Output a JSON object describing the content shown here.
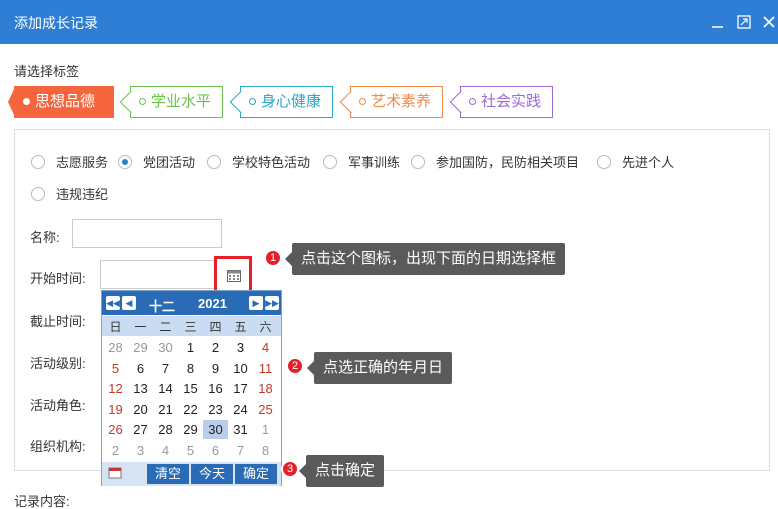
{
  "dialog": {
    "title": "添加成长记录",
    "icons": [
      "minimize-icon",
      "maximize-icon",
      "close-icon"
    ]
  },
  "section_label": "请选择标签",
  "tags": [
    {
      "label": "思想品德",
      "color": "#f5653e",
      "active": true
    },
    {
      "label": "学业水平",
      "color": "#6cc24a",
      "active": false
    },
    {
      "label": "身心健康",
      "color": "#2aa7c9",
      "active": false
    },
    {
      "label": "艺术素养",
      "color": "#f08c4a",
      "active": false
    },
    {
      "label": "社会实践",
      "color": "#9b6ad6",
      "active": false
    }
  ],
  "categories": {
    "options": [
      "志愿服务",
      "党团活动",
      "学校特色活动",
      "军事训练",
      "参加国防，民防相关项目",
      "先进个人",
      "违规违纪"
    ],
    "selected": "党团活动"
  },
  "form": {
    "name_label": "名称:",
    "start_label": "开始时间:",
    "end_label": "截止时间:",
    "level_label": "活动级别:",
    "role_label": "活动角色:",
    "org_label": "组织机构:",
    "record_label": "记录内容:"
  },
  "calendar": {
    "month": "十二",
    "year": "2021",
    "weekdays": [
      "日",
      "一",
      "二",
      "三",
      "四",
      "五",
      "六"
    ],
    "weeks": [
      [
        "28",
        "29",
        "30",
        "1",
        "2",
        "3",
        "4"
      ],
      [
        "5",
        "6",
        "7",
        "8",
        "9",
        "10",
        "11"
      ],
      [
        "12",
        "13",
        "14",
        "15",
        "16",
        "17",
        "18"
      ],
      [
        "19",
        "20",
        "21",
        "22",
        "23",
        "24",
        "25"
      ],
      [
        "26",
        "27",
        "28",
        "29",
        "30",
        "31",
        "1"
      ],
      [
        "2",
        "3",
        "4",
        "5",
        "6",
        "7",
        "8"
      ]
    ],
    "selected_day": "30",
    "clear_label": "清空",
    "today_label": "今天",
    "ok_label": "确定"
  },
  "callouts": [
    {
      "number": "1",
      "text": "点击这个图标，出现下面的日期选择框"
    },
    {
      "number": "2",
      "text": "点选正确的年月日"
    },
    {
      "number": "3",
      "text": "点击确定"
    }
  ],
  "colors": {
    "title_bar": "#2e7ed6",
    "active_tag": "#f5653e",
    "calendar_header": "#2a6bb5",
    "highlight_border": "#e5202b",
    "callout_bg": "#5a5a5a"
  }
}
